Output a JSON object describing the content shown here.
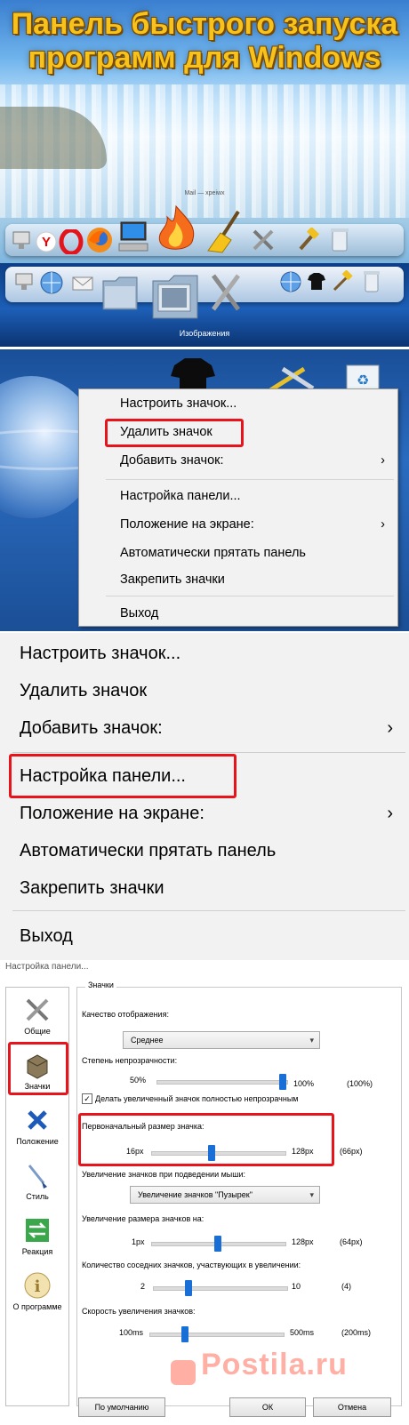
{
  "banner": {
    "title_line1": "Панель быстрого запуска",
    "title_line2": "программ для Windows",
    "caption": "Mail — xpeiwx"
  },
  "dock2": {
    "caption": "Изображения"
  },
  "context_menu": {
    "items": [
      {
        "label": "Настроить значок...",
        "submenu": false
      },
      {
        "label": "Удалить значок",
        "submenu": false
      },
      {
        "label": "Добавить значок:",
        "submenu": true
      },
      {
        "label": "Настройка панели...",
        "submenu": false
      },
      {
        "label": "Положение на экране:",
        "submenu": true
      },
      {
        "label": "Автоматически прятать панель",
        "submenu": false
      },
      {
        "label": "Закрепить значки",
        "submenu": false
      },
      {
        "label": "Выход",
        "submenu": false
      }
    ],
    "arrow": "›"
  },
  "dialog": {
    "title": "Настройка панели...",
    "sidebar": [
      {
        "label": "Общие",
        "icon": "tools-icon"
      },
      {
        "label": "Значки",
        "icon": "box-icon"
      },
      {
        "label": "Положение",
        "icon": "move-icon"
      },
      {
        "label": "Стиль",
        "icon": "brush-icon"
      },
      {
        "label": "Реакция",
        "icon": "arrows-icon"
      },
      {
        "label": "О программе",
        "icon": "info-icon"
      }
    ],
    "group_title": "Значки",
    "quality_label": "Качество отображения:",
    "quality_value": "Среднее",
    "opacity_label": "Степень непрозрачности:",
    "opacity_min": "50%",
    "opacity_max": "100%",
    "opacity_value": "(100%)",
    "opaque_checkbox": "Делать увеличенный значок полностью непрозрачным",
    "size_label": "Первоначальный размер значка:",
    "size_min": "16px",
    "size_max": "128px",
    "size_value": "(66px)",
    "hover_label": "Увеличение значков при подведении мыши:",
    "hover_value": "Увеличение значков \"Пузырек\"",
    "grow_label": "Увеличение размера значков на:",
    "grow_min": "1px",
    "grow_max": "128px",
    "grow_value": "(64px)",
    "neighbors_label": "Количество соседних значков, участвующих в увеличении:",
    "neighbors_min": "2",
    "neighbors_max": "10",
    "neighbors_value": "(4)",
    "speed_label": "Скорость увеличения значков:",
    "speed_min": "100ms",
    "speed_max": "500ms",
    "speed_value": "(200ms)",
    "btn_default": "По умолчанию",
    "btn_ok": "ОК",
    "btn_cancel": "Отмена",
    "slider_levels": {
      "opacity": 1.0,
      "size": 0.45,
      "grow": 0.5,
      "neighbors": 0.25,
      "speed": 0.25
    }
  },
  "watermark": "Postila.ru",
  "colors": {
    "highlight": "#e8141c",
    "slider": "#1a6fd6",
    "title": "#f6c21b"
  }
}
